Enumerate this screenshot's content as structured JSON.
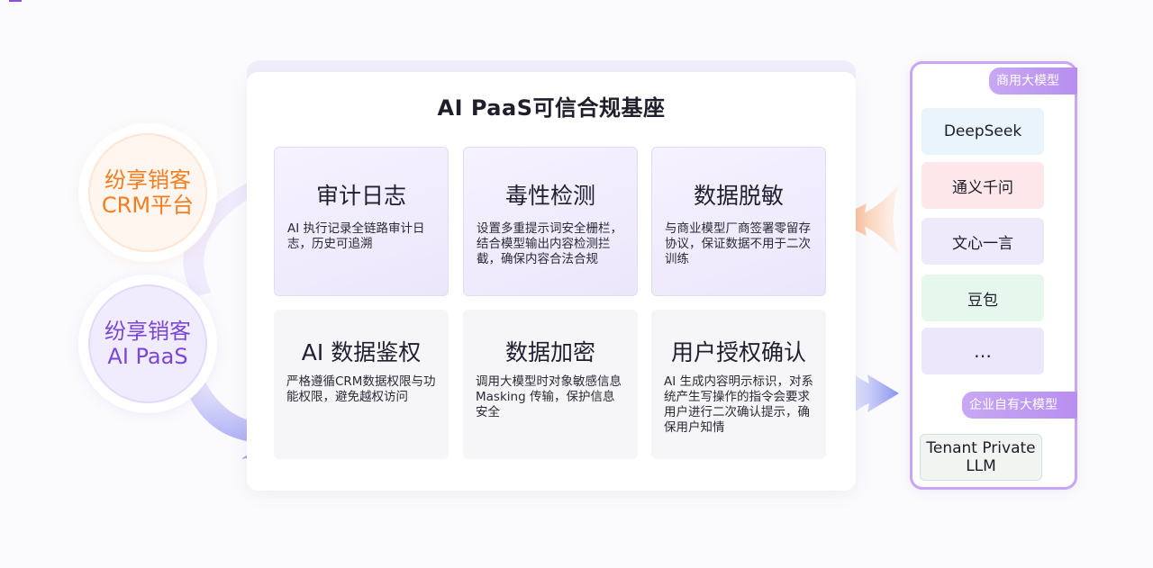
{
  "left": {
    "crm_circle": {
      "line1": "纷享销客",
      "line2": "CRM平台"
    },
    "paas_circle": {
      "line1": "纷享销客",
      "line2": "AI PaaS"
    }
  },
  "main": {
    "title": "AI PaaS可信合规基座",
    "tiles": [
      {
        "title": "审计日志",
        "desc": "AI 执行记录全链路审计日志，历史可追溯"
      },
      {
        "title": "毒性检测",
        "desc": "设置多重提示词安全栅栏，结合模型输出内容检测拦截，确保内容合法合规"
      },
      {
        "title": "数据脱敏",
        "desc": "与商业模型厂商签署零留存协议，保证数据不用于二次训练"
      },
      {
        "title": "AI 数据鉴权",
        "desc": "严格遵循CRM数据权限与功能权限，避免越权访问"
      },
      {
        "title": "数据加密",
        "desc": "调用大模型时对象敏感信息 Masking 传输，保护信息安全"
      },
      {
        "title": "用户授权确认",
        "desc": "AI 生成内容明示标识，对系统产生写操作的指令会要求用户进行二次确认提示，确保用户知情"
      }
    ]
  },
  "right": {
    "commercial_tag": "商用大模型",
    "models": [
      "DeepSeek",
      "通义千问",
      "文心一言",
      "豆包",
      "…"
    ],
    "private_tag": "企业自有大模型",
    "private_model": "Tenant Private LLM"
  },
  "colors": {
    "crm_orange": "#f57c1f",
    "paas_purple": "#7a46d8",
    "panel_border": "#c6a6f5",
    "arrow_orange": "#f7a36d",
    "arrow_blue": "#8e96f0"
  }
}
